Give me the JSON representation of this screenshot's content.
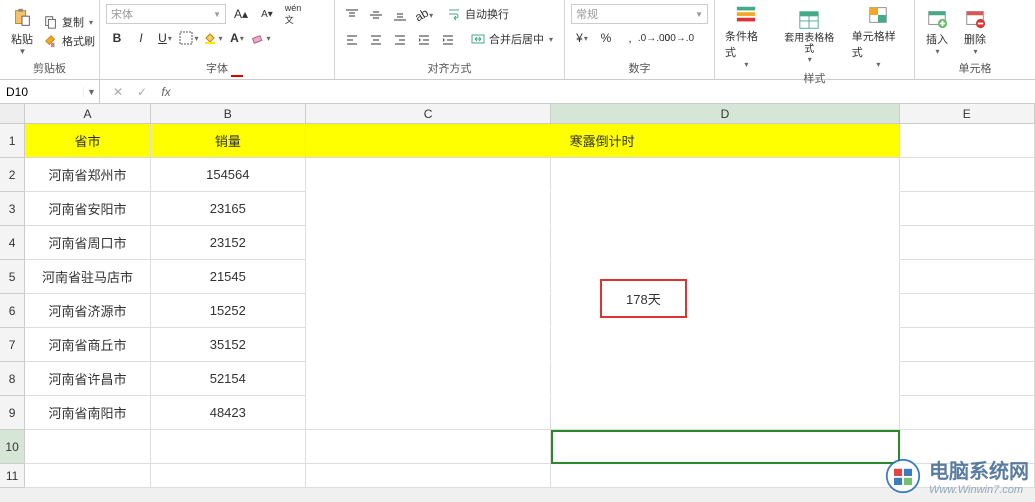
{
  "ribbon": {
    "clipboard": {
      "label": "剪贴板",
      "paste": "粘贴",
      "copy": "复制",
      "formatPainter": "格式刷"
    },
    "font": {
      "label": "字体",
      "fontFace": "宋体",
      "bold": "B",
      "italic": "I",
      "underline": "U"
    },
    "alignment": {
      "label": "对齐方式",
      "wrap": "自动换行",
      "merge": "合并后居中"
    },
    "number": {
      "label": "数字",
      "format": "常规"
    },
    "styles": {
      "label": "样式",
      "cond": "条件格式",
      "table": "套用表格格式",
      "cell": "单元格样式"
    },
    "cells": {
      "label": "单元格",
      "insert": "插入",
      "delete": "删除"
    }
  },
  "namebox": "D10",
  "formula": "",
  "columns": [
    "A",
    "B",
    "C",
    "D",
    "E"
  ],
  "rows": [
    "1",
    "2",
    "3",
    "4",
    "5",
    "6",
    "7",
    "8",
    "9",
    "10",
    "11"
  ],
  "headers": {
    "province": "省市",
    "sales": "销量",
    "countdown": "寒露倒计时"
  },
  "chart_data": {
    "type": "table",
    "title": "寒露倒计时",
    "columns": [
      "省市",
      "销量"
    ],
    "rows": [
      [
        "河南省郑州市",
        154564
      ],
      [
        "河南省安阳市",
        23165
      ],
      [
        "河南省周口市",
        23152
      ],
      [
        "河南省驻马店市",
        21545
      ],
      [
        "河南省济源市",
        15252
      ],
      [
        "河南省商丘市",
        35152
      ],
      [
        "河南省许昌市",
        52154
      ],
      [
        "河南省南阳市",
        48423
      ]
    ]
  },
  "callout": "178天",
  "activeCell": "D10",
  "watermark": {
    "title": "电脑系统网",
    "sub": "Www.Winwin7.com"
  }
}
